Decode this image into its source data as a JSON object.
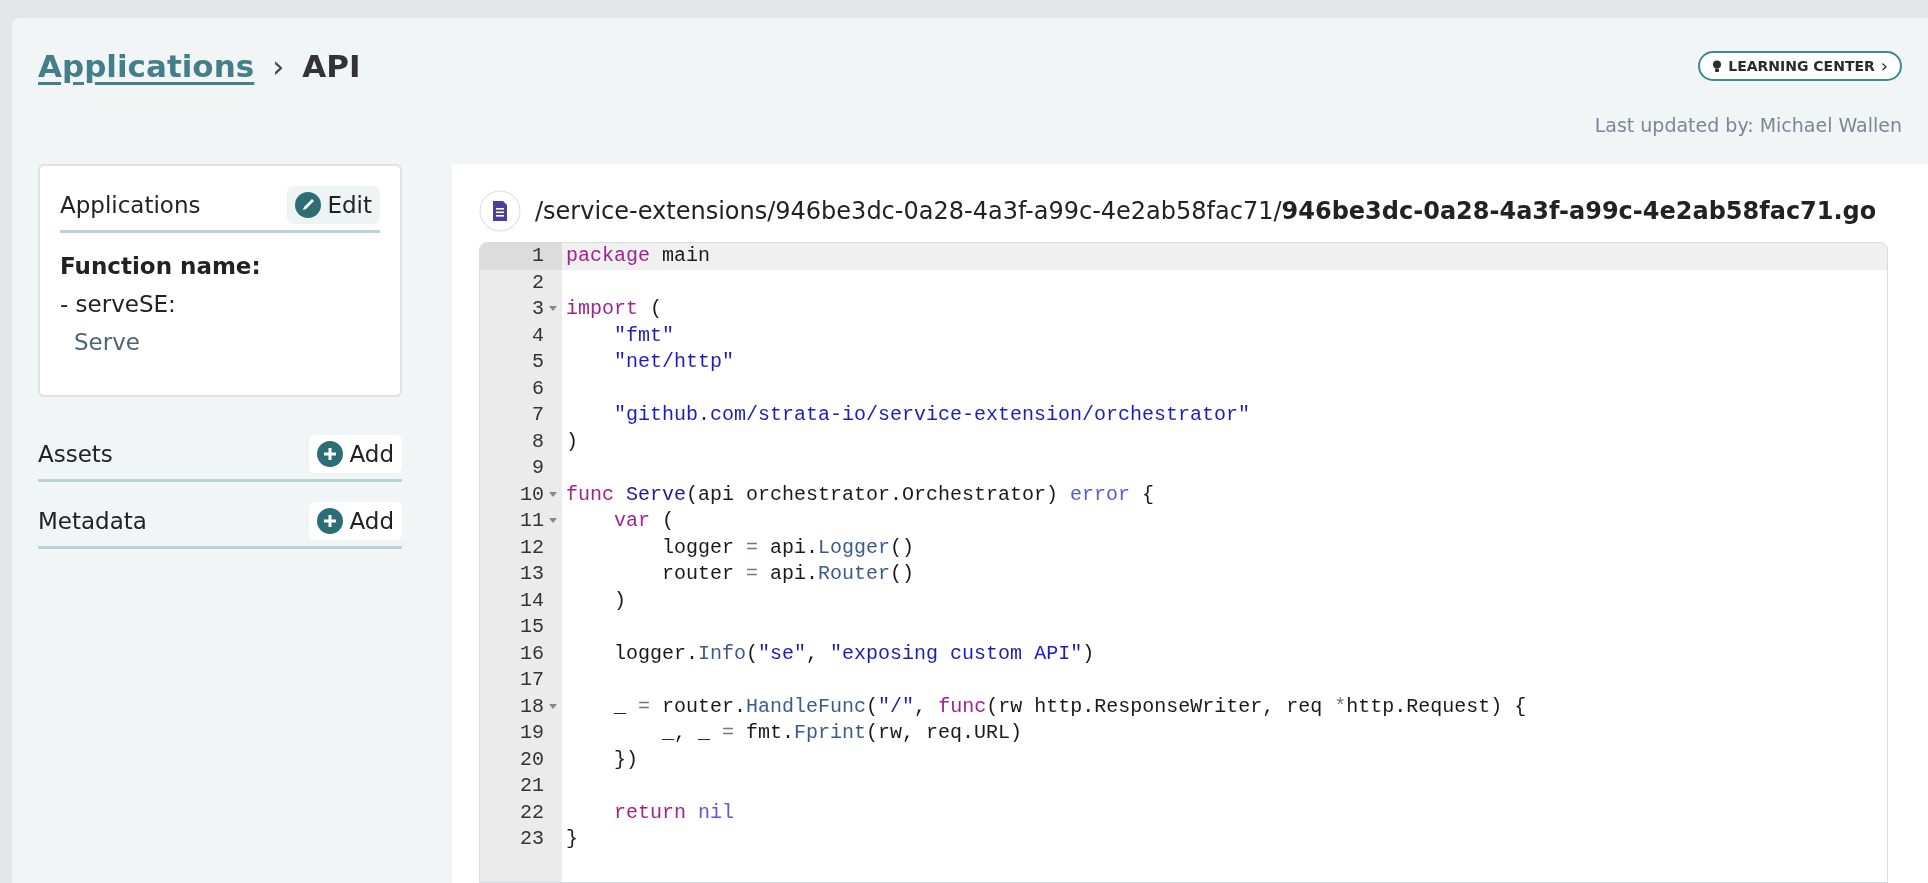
{
  "breadcrumb": {
    "parent": "Applications",
    "separator": "›",
    "current": "API"
  },
  "learning_center": {
    "label": "LEARNING CENTER",
    "chevron": "›"
  },
  "last_updated": "Last updated by: Michael Wallen",
  "sidebar": {
    "card": {
      "title": "Applications",
      "edit_label": "Edit",
      "field_label": "Function name:",
      "entry": "- serveSE:",
      "value": "Serve"
    },
    "sections": [
      {
        "title": "Assets",
        "add_label": "Add"
      },
      {
        "title": "Metadata",
        "add_label": "Add"
      }
    ]
  },
  "file": {
    "path": "/service-extensions/946be3dc-0a28-4a3f-a99c-4e2ab58fac71/",
    "name": "946be3dc-0a28-4a3f-a99c-4e2ab58fac71.go"
  },
  "editor": {
    "lines": [
      {
        "number": "1",
        "foldable": false,
        "selected": true,
        "tokens": [
          {
            "kind": "kw",
            "text": "package"
          },
          {
            "kind": "plain",
            "text": " main"
          }
        ]
      },
      {
        "number": "2",
        "foldable": false,
        "selected": false
      },
      {
        "number": "3",
        "foldable": true,
        "selected": false,
        "tokens": [
          {
            "kind": "kw",
            "text": "import"
          },
          {
            "kind": "plain",
            "text": " ("
          }
        ]
      },
      {
        "number": "4",
        "foldable": false,
        "selected": false,
        "tokens": [
          {
            "kind": "str",
            "text": "    \"fmt\""
          }
        ]
      },
      {
        "number": "5",
        "foldable": false,
        "selected": false,
        "tokens": [
          {
            "kind": "str",
            "text": "    \"net/http\""
          }
        ]
      },
      {
        "number": "6",
        "foldable": false,
        "selected": false
      },
      {
        "number": "7",
        "foldable": false,
        "selected": false,
        "tokens": [
          {
            "kind": "str",
            "text": "    \"github.com/strata-io/service-extension/orchestrator\""
          }
        ]
      },
      {
        "number": "8",
        "foldable": false,
        "selected": false,
        "tokens": [
          {
            "kind": "plain",
            "text": ")"
          }
        ]
      },
      {
        "number": "9",
        "foldable": false,
        "selected": false
      },
      {
        "number": "10",
        "foldable": true,
        "selected": false,
        "tokens": [
          {
            "kind": "kw",
            "text": "func"
          },
          {
            "kind": "def",
            "text": " Serve"
          },
          {
            "kind": "plain",
            "text": "(api orchestrator.Orchestrator) "
          },
          {
            "kind": "builtin",
            "text": "error"
          },
          {
            "kind": "plain",
            "text": " {"
          }
        ]
      },
      {
        "number": "11",
        "foldable": true,
        "selected": false,
        "tokens": [
          {
            "kind": "kw",
            "text": "    var"
          },
          {
            "kind": "plain",
            "text": " ("
          }
        ]
      },
      {
        "number": "12",
        "foldable": false,
        "selected": false,
        "tokens": [
          {
            "kind": "plain",
            "text": "        logger "
          },
          {
            "kind": "op",
            "text": "="
          },
          {
            "kind": "plain",
            "text": " api."
          },
          {
            "kind": "method",
            "text": "Logger"
          },
          {
            "kind": "plain",
            "text": "()"
          }
        ]
      },
      {
        "number": "13",
        "foldable": false,
        "selected": false,
        "tokens": [
          {
            "kind": "plain",
            "text": "        router "
          },
          {
            "kind": "op",
            "text": "="
          },
          {
            "kind": "plain",
            "text": " api."
          },
          {
            "kind": "method",
            "text": "Router"
          },
          {
            "kind": "plain",
            "text": "()"
          }
        ]
      },
      {
        "number": "14",
        "foldable": false,
        "selected": false,
        "tokens": [
          {
            "kind": "plain",
            "text": "    )"
          }
        ]
      },
      {
        "number": "15",
        "foldable": false,
        "selected": false
      },
      {
        "number": "16",
        "foldable": false,
        "selected": false,
        "tokens": [
          {
            "kind": "plain",
            "text": "    logger."
          },
          {
            "kind": "method",
            "text": "Info"
          },
          {
            "kind": "plain",
            "text": "("
          },
          {
            "kind": "str",
            "text": "\"se\""
          },
          {
            "kind": "plain",
            "text": ", "
          },
          {
            "kind": "str",
            "text": "\"exposing custom API\""
          },
          {
            "kind": "plain",
            "text": ")"
          }
        ]
      },
      {
        "number": "17",
        "foldable": false,
        "selected": false
      },
      {
        "number": "18",
        "foldable": true,
        "selected": false,
        "tokens": [
          {
            "kind": "plain",
            "text": "    _ "
          },
          {
            "kind": "op",
            "text": "="
          },
          {
            "kind": "plain",
            "text": " router."
          },
          {
            "kind": "method",
            "text": "HandleFunc"
          },
          {
            "kind": "plain",
            "text": "("
          },
          {
            "kind": "str",
            "text": "\"/\""
          },
          {
            "kind": "plain",
            "text": ", "
          },
          {
            "kind": "kw",
            "text": "func"
          },
          {
            "kind": "plain",
            "text": "(rw http.ResponseWriter, req "
          },
          {
            "kind": "op",
            "text": "*"
          },
          {
            "kind": "plain",
            "text": "http.Request) {"
          }
        ]
      },
      {
        "number": "19",
        "foldable": false,
        "selected": false,
        "tokens": [
          {
            "kind": "plain",
            "text": "        _, _ "
          },
          {
            "kind": "op",
            "text": "="
          },
          {
            "kind": "plain",
            "text": " fmt."
          },
          {
            "kind": "method",
            "text": "Fprint"
          },
          {
            "kind": "plain",
            "text": "(rw, req.URL)"
          }
        ]
      },
      {
        "number": "20",
        "foldable": false,
        "selected": false,
        "tokens": [
          {
            "kind": "plain",
            "text": "    })"
          }
        ]
      },
      {
        "number": "21",
        "foldable": false,
        "selected": false
      },
      {
        "number": "22",
        "foldable": false,
        "selected": false,
        "tokens": [
          {
            "kind": "kw",
            "text": "    return"
          },
          {
            "kind": "builtin",
            "text": " nil"
          }
        ]
      },
      {
        "number": "23",
        "foldable": false,
        "selected": false,
        "tokens": [
          {
            "kind": "plain",
            "text": "}"
          }
        ]
      }
    ]
  }
}
